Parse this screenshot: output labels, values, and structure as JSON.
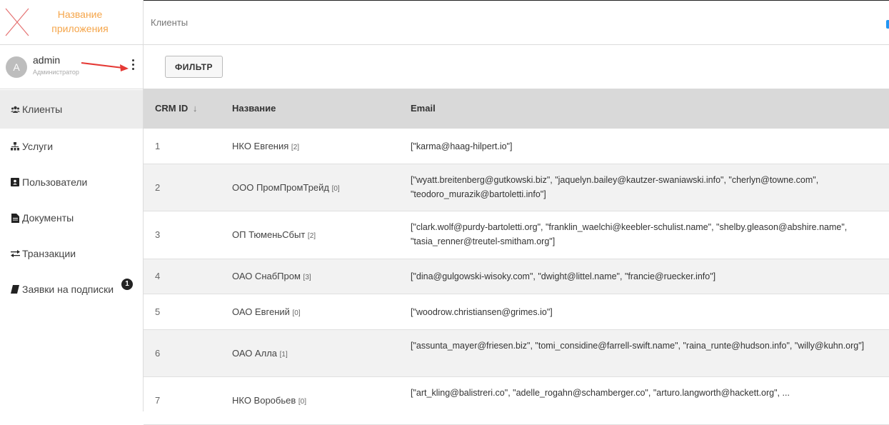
{
  "app": {
    "title_line1": "Название",
    "title_line2": "приложения",
    "accent": "#f5a54a"
  },
  "user": {
    "avatar_letter": "A",
    "name": "admin",
    "role": "Администратор"
  },
  "nav": [
    {
      "label": "Клиенты",
      "icon": "users-icon",
      "active": true
    },
    {
      "label": "Услуги",
      "icon": "sitemap-icon",
      "active": false
    },
    {
      "label": "Пользователи",
      "icon": "address-card-icon",
      "active": false
    },
    {
      "label": "Документы",
      "icon": "file-icon",
      "active": false
    },
    {
      "label": "Транзакции",
      "icon": "exchange-icon",
      "active": false
    },
    {
      "label": "Заявки на подписки",
      "icon": "book-icon",
      "active": false,
      "badge": "1"
    }
  ],
  "header": {
    "title": "Клиенты"
  },
  "toolbar": {
    "filter_label": "ФИЛЬТР"
  },
  "table": {
    "columns": {
      "id": "CRM ID",
      "sort_arrow": "↓",
      "name": "Название",
      "email": "Email"
    },
    "rows": [
      {
        "id": "1",
        "name": "НКО Евгения",
        "count": "[2]",
        "email": "[\"karma@haag-hilpert.io\"]"
      },
      {
        "id": "2",
        "name": "ООО ПромПромТрейд",
        "count": "[0]",
        "email": "[\"wyatt.breitenberg@gutkowski.biz\", \"jaquelyn.bailey@kautzer-swaniawski.info\", \"cherlyn@towne.com\", \"teodoro_murazik@bartoletti.info\"]"
      },
      {
        "id": "3",
        "name": "ОП ТюменьСбыт",
        "count": "[2]",
        "email": "[\"clark.wolf@purdy-bartoletti.org\", \"franklin_waelchi@keebler-schulist.name\", \"shelby.gleason@abshire.name\", \"tasia_renner@treutel-smitham.org\"]"
      },
      {
        "id": "4",
        "name": "ОАО СнабПром",
        "count": "[3]",
        "email": "[\"dina@gulgowski-wisoky.com\", \"dwight@littel.name\", \"francie@ruecker.info\"]"
      },
      {
        "id": "5",
        "name": "ОАО Евгений",
        "count": "[0]",
        "email": "[\"woodrow.christiansen@grimes.io\"]"
      },
      {
        "id": "6",
        "name": "ОАО Алла",
        "count": "[1]",
        "email": "[\"assunta_mayer@friesen.biz\", \"tomi_considine@farrell-swift.name\", \"raina_runte@hudson.info\", \"willy@kuhn.org\"]"
      },
      {
        "id": "7",
        "name": "НКО Воробьев",
        "count": "[0]",
        "email": "[\"art_kling@balistreri.co\", \"adelle_rogahn@schamberger.co\", \"arturo.langworth@hackett.org\", ..."
      }
    ]
  }
}
